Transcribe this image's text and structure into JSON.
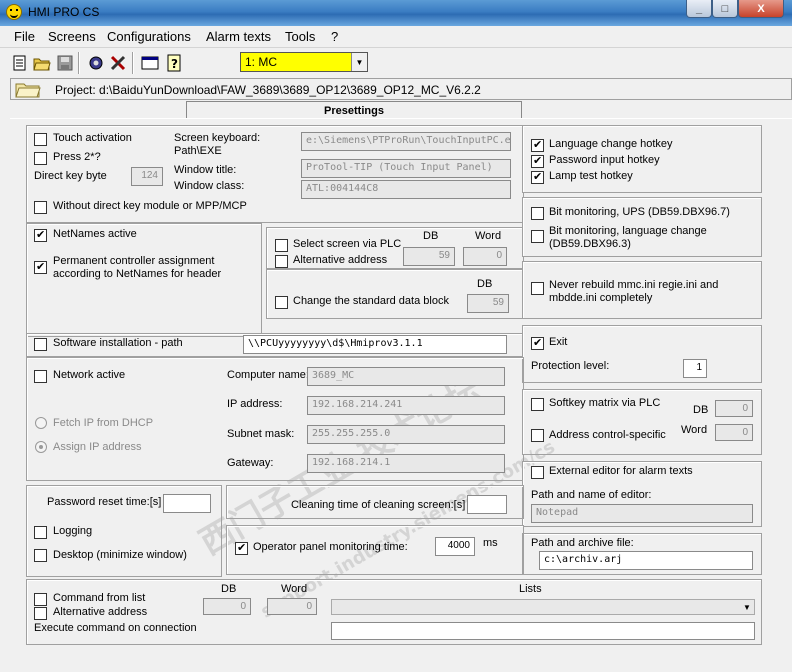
{
  "window": {
    "title": "HMI PRO CS",
    "min": "_",
    "max": "□",
    "close": "X"
  },
  "menu": [
    "File",
    "Screens",
    "Configurations",
    "Alarm texts",
    "Tools",
    "?"
  ],
  "toolbar": {
    "screen_select": "1: MC"
  },
  "project": {
    "label": "Project: d:\\BaiduYunDownload\\FAW_3689\\3689_OP12\\3689_OP12_MC_V6.2.2"
  },
  "tab": {
    "label": "Presettings"
  },
  "touch": {
    "touch_activation": "Touch activation",
    "press2": "Press 2*?",
    "direct_key_byte": "Direct key byte",
    "direct_key_value": "124",
    "keyboard_label": "Screen keyboard: Path\\EXE",
    "keyboard_value": "e:\\Siemens\\PTProRun\\TouchInputPC.e",
    "window_title_label": "Window title:",
    "window_title_value": "ProTool-TIP (Touch Input Panel)",
    "window_class_label": "Window class:",
    "window_class_value": "ATL:004144C8",
    "without_direct": "Without direct key module or MPP/MCP"
  },
  "hotkeys": {
    "language": "Language change hotkey",
    "password": "Password input hotkey",
    "lamp": "Lamp test hotkey"
  },
  "netnames": {
    "active": "NetNames active",
    "permanent": "Permanent controller assignment according to NetNames for header"
  },
  "plc": {
    "db_label": "DB",
    "word_label": "Word",
    "select_screen": "Select screen via PLC",
    "alt_address": "Alternative address",
    "db_value": "59",
    "word_value": "0",
    "change_db": "Change the standard data block",
    "change_db_label": "DB",
    "change_db_value": "59"
  },
  "bitmon": {
    "ups": "Bit monitoring, UPS (DB59.DBX96.7)",
    "lang": "Bit monitoring, language change (DB59.DBX96.3)"
  },
  "rebuild": {
    "label": "Never rebuild mmc.ini regie.ini and mbdde.ini completely"
  },
  "software": {
    "label": "Software installation - path",
    "value": "\\\\PCUyyyyyyyy\\d$\\Hmiprov3.1.1"
  },
  "exit": {
    "label": "Exit",
    "protection_label": "Protection level:",
    "protection_value": "1"
  },
  "network": {
    "active": "Network active",
    "dhcp": "Fetch IP from DHCP",
    "assign": "Assign IP address",
    "computer_label": "Computer name:",
    "computer_value": "3689_MC",
    "ip_label": "IP address:",
    "ip_value": "192.168.214.241",
    "subnet_label": "Subnet mask:",
    "subnet_value": "255.255.255.0",
    "gateway_label": "Gateway:",
    "gateway_value": "192.168.214.1"
  },
  "softkey": {
    "matrix": "Softkey matrix via PLC",
    "addr": "Address control-specific",
    "db_label": "DB",
    "db_value": "0",
    "word_label": "Word",
    "word_value": "0"
  },
  "editor": {
    "external": "External editor for alarm texts",
    "path_label": "Path and name of editor:",
    "path_value": "Notepad"
  },
  "archive": {
    "label": "Path and archive file:",
    "value": "c:\\archiv.arj"
  },
  "misc": {
    "password_reset": "Password reset time:[s]",
    "logging": "Logging",
    "desktop": "Desktop (minimize window)",
    "cleaning": "Cleaning time of cleaning screen:[s]",
    "op_monitor": "Operator panel monitoring time:",
    "op_monitor_value": "4000",
    "ms": "ms"
  },
  "command": {
    "from_list": "Command from list",
    "alt_address": "Alternative address",
    "execute": "Execute command on connection",
    "db_label": "DB",
    "db_value": "0",
    "word_label": "Word",
    "word_value": "0",
    "lists_label": "Lists"
  },
  "watermark": {
    "line1": "西门子工业  技术论坛",
    "line2": "support.industry.siemens.com/cs"
  }
}
